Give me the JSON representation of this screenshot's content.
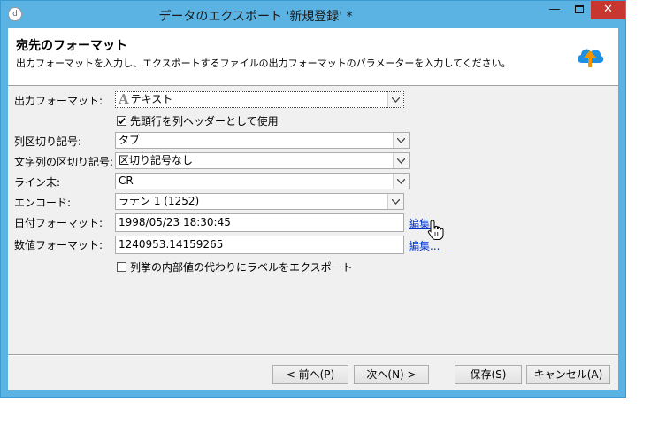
{
  "window": {
    "title": "データのエクスポート '新規登録' *",
    "app_icon_glyph": "d",
    "controls": {
      "minimize": "—",
      "close": "✕"
    }
  },
  "header": {
    "title": "宛先のフォーマット",
    "subtitle": "出力フォーマットを入力し、エクスポートするファイルの出力フォーマットのパラメーターを入力してください。",
    "icon": "cloud-upload-icon"
  },
  "form": {
    "output_format": {
      "label": "出力フォーマット:",
      "value": "テキスト",
      "icon_glyph": "A"
    },
    "header_checkbox": {
      "label": "先頭行を列ヘッダーとして使用",
      "checked": true
    },
    "column_separator": {
      "label": "列区切り記号:",
      "value": "タブ"
    },
    "string_delimiter": {
      "label": "文字列の区切り記号:",
      "value": "区切り記号なし"
    },
    "line_end": {
      "label": "ライン末:",
      "value": "CR"
    },
    "encoding": {
      "label": "エンコード:",
      "value": "ラテン 1 (1252)"
    },
    "date_format": {
      "label": "日付フォーマット:",
      "value": "1998/05/23 18:30:45",
      "edit_link": "編集..."
    },
    "number_format": {
      "label": "数値フォーマット:",
      "value": "1240953.14159265",
      "edit_link": "編集..."
    },
    "enum_checkbox": {
      "label": "列挙の内部値の代わりにラベルをエクスポート",
      "checked": false
    }
  },
  "buttons": {
    "back": "< 前へ(P)",
    "next": "次へ(N) >",
    "save": "保存(S)",
    "cancel": "キャンセル(A)"
  },
  "colors": {
    "titlebar": "#5ab3e3",
    "close": "#c7372f",
    "link": "#0033cc",
    "icon": "#1e90e0",
    "arrow": "#f29400"
  }
}
